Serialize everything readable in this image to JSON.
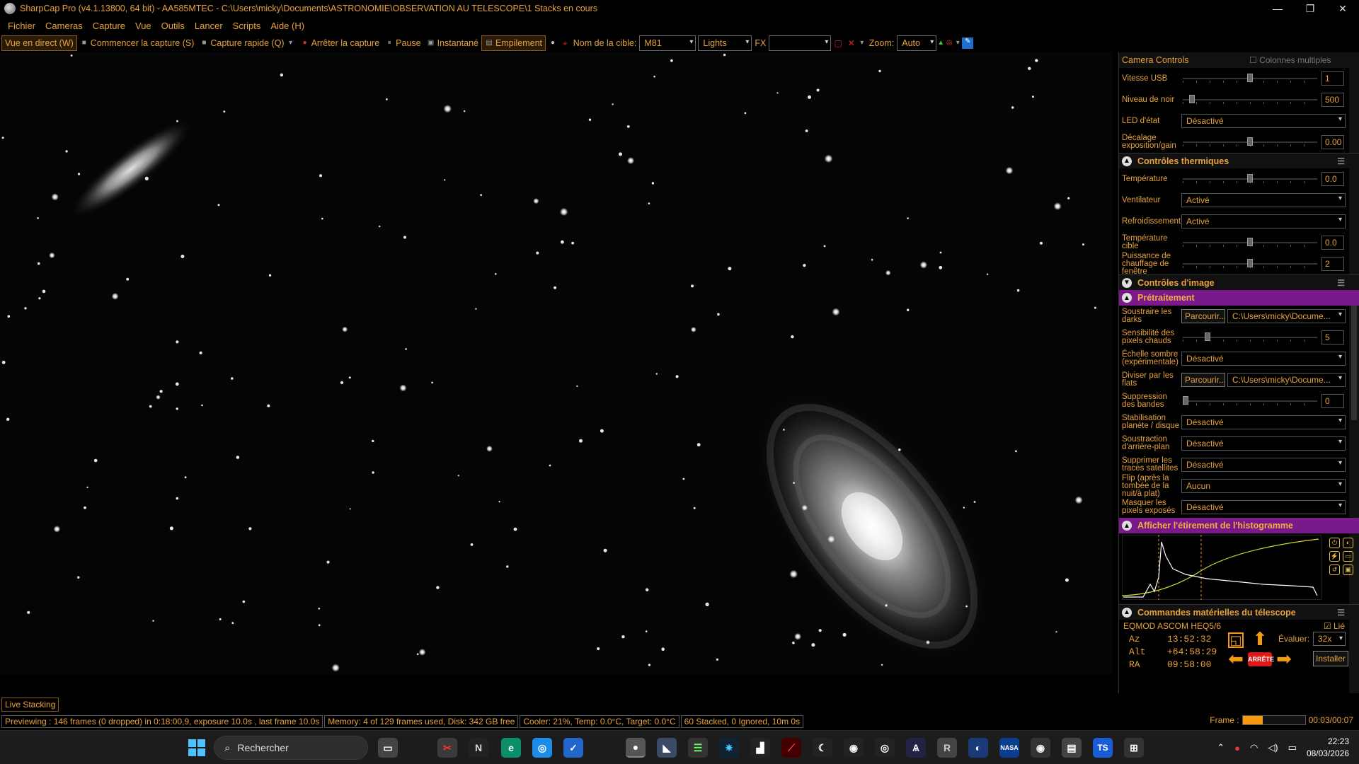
{
  "window": {
    "title": "SharpCap Pro (v4.1.13800, 64 bit) - AA585MTEC - C:\\Users\\micky\\Documents\\ASTRONOMIE\\OBSERVATION AU TELESCOPE\\1 Stacks en cours",
    "min": "—",
    "max": "❐",
    "close": "✕"
  },
  "menu": [
    "Fichier",
    "Cameras",
    "Capture",
    "Vue",
    "Outils",
    "Lancer",
    "Scripts",
    "Aide (H)"
  ],
  "toolbar": {
    "live_view": "Vue en direct (W)",
    "start_capture": "Commencer la capture (S)",
    "quick_capture": "Capture rapide (Q)",
    "stop_capture": "Arrêter la capture",
    "pause": "Pause",
    "snapshot": "Instantané",
    "stacking": "Empilement",
    "target_label": "Nom de la cible:",
    "target_value": "M81",
    "frame_type": "Lights",
    "fx_label": "FX",
    "fx_value": "",
    "zoom_label": "Zoom:",
    "zoom_value": "Auto"
  },
  "panel": {
    "camera_controls_title": "Camera Controls",
    "multi_columns": "Colonnes multiples",
    "usb_speed": {
      "label": "Vitesse USB",
      "value": "1",
      "pos": 0.5
    },
    "black_level": {
      "label": "Niveau de noir",
      "value": "500",
      "pos": 0.05
    },
    "status_led": {
      "label": "LED d'état",
      "value": "Désactivé"
    },
    "exposure_gain_offset": {
      "label": "Décalage exposition/gain",
      "value": "0.00",
      "pos": 0.5
    },
    "thermal_title": "Contrôles thermiques",
    "temperature": {
      "label": "Température",
      "value": "0.0",
      "pos": 0.5
    },
    "fan": {
      "label": "Ventilateur",
      "value": "Activé"
    },
    "cooling": {
      "label": "Refroidissement",
      "value": "Activé"
    },
    "target_temp": {
      "label": "Température cible",
      "value": "0.0",
      "pos": 0.5
    },
    "heater_power": {
      "label": "Puissance de chauffage de fenêtre",
      "value": "2",
      "pos": 0.5
    },
    "image_controls_title": "Contrôles d'image",
    "preprocessing_title": "Prétraitement",
    "subtract_darks": {
      "label": "Soustraire les darks",
      "button": "Parcourir...",
      "path": "C:\\Users\\micky\\Docume..."
    },
    "hot_pixel": {
      "label": "Sensibilité des pixels chauds",
      "value": "5",
      "pos": 0.17
    },
    "dark_scale": {
      "label": "Échelle sombre (expérimentale)",
      "value": "Désactivé"
    },
    "divide_flats": {
      "label": "Diviser par les flats",
      "button": "Parcourir...",
      "path": "C:\\Users\\micky\\Docume..."
    },
    "banding": {
      "label": "Suppression des bandes",
      "value": "0",
      "pos": 0.0
    },
    "planet_stab": {
      "label": "Stabilisation planète / disque",
      "value": "Désactivé"
    },
    "bg_subtract": {
      "label": "Soustraction d'arrière-plan",
      "value": "Désactivé"
    },
    "satellite": {
      "label": "Supprimer les traces satellites",
      "value": "Désactivé"
    },
    "flip": {
      "label": "Flip (après la tombée de la nuit/à plat)",
      "value": "Aucun"
    },
    "mask_pixels": {
      "label": "Masquer les pixels exposés",
      "value": "Désactivé"
    },
    "histogram_title": "Afficher l'étirement de l'histogramme",
    "telescope_title": "Commandes matérielles du télescope",
    "mount_name": "EQMOD ASCOM HEQ5/6",
    "linked": "Lié",
    "az_label": "Az",
    "az_value": "13:52:32",
    "alt_label": "Alt",
    "alt_value": "+64:58:29",
    "ra_label": "RA",
    "ra_value": "09:58:00",
    "rate_label": "Évaluer:",
    "rate_value": "32x",
    "install": "Installer",
    "stop": "ARRÊTE"
  },
  "live_stacking_tab": "Live Stacking",
  "status": {
    "preview": "Previewing : 146 frames (0 dropped) in 0:18:00,9, exposure 10.0s , last frame 10.0s",
    "memory": "Memory: 4 of 129 frames used, Disk: 342 GB free",
    "cooler": "Cooler: 21%, Temp: 0.0°C, Target: 0.0°C",
    "stacked": "60 Stacked, 0 Ignored, 10m 0s",
    "frame_label": "Frame :",
    "frame_progress": 0.32,
    "time": "00:03/00:07"
  },
  "taskbar": {
    "search": "Rechercher",
    "time": "22:23",
    "date": "08/03/2026"
  },
  "colors": {
    "accent": "#e8a23a",
    "magenta_header": "#7a1a8a",
    "orange_button": "#f39a10"
  }
}
